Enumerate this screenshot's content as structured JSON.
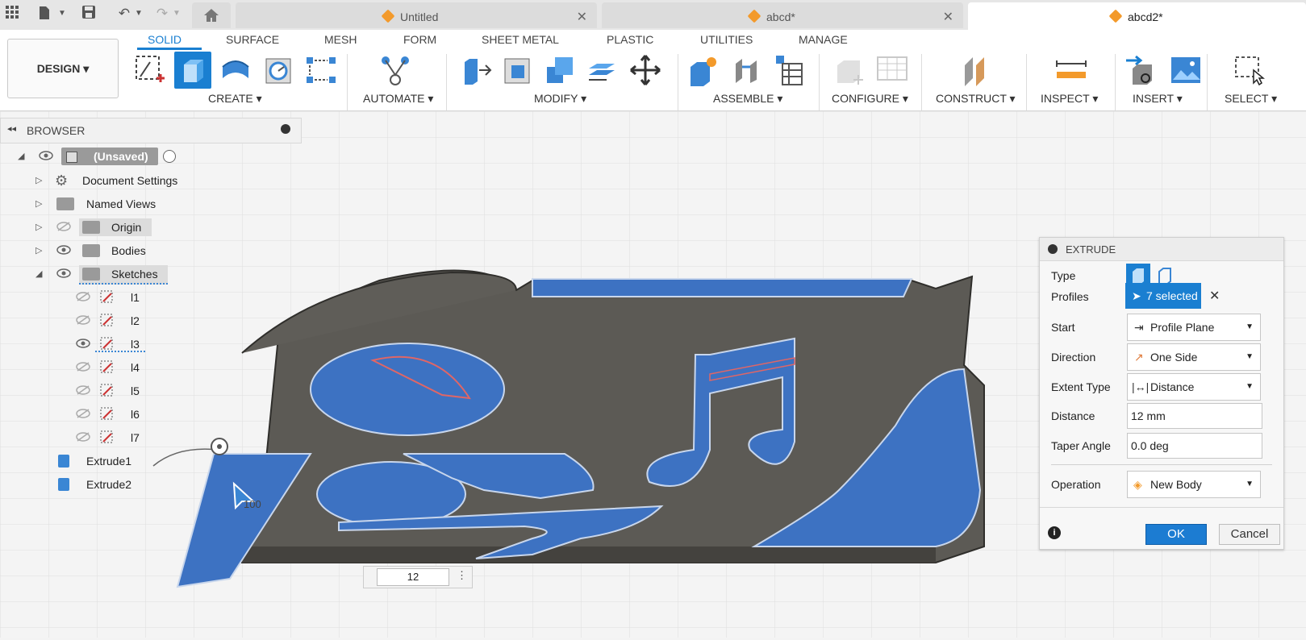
{
  "tabs": [
    {
      "label": "Untitled",
      "active": false
    },
    {
      "label": "abcd*",
      "active": false
    },
    {
      "label": "abcd2*",
      "active": true
    }
  ],
  "workspace": {
    "design_label": "DESIGN",
    "tabs": [
      "SOLID",
      "SURFACE",
      "MESH",
      "FORM",
      "SHEET METAL",
      "PLASTIC",
      "UTILITIES",
      "MANAGE"
    ],
    "groups": [
      "CREATE",
      "AUTOMATE",
      "MODIFY",
      "ASSEMBLE",
      "CONFIGURE",
      "CONSTRUCT",
      "INSPECT",
      "INSERT",
      "SELECT"
    ]
  },
  "browser": {
    "title": "BROWSER",
    "root": "(Unsaved)",
    "items": [
      "Document Settings",
      "Named Views",
      "Origin",
      "Bodies",
      "Sketches"
    ],
    "sketches": [
      "l1",
      "l2",
      "l3",
      "l4",
      "l5",
      "l6",
      "l7"
    ],
    "features": [
      "Extrude1",
      "Extrude2"
    ]
  },
  "extrude": {
    "title": "EXTRUDE",
    "type_label": "Type",
    "profiles_label": "Profiles",
    "profiles_value": "7 selected",
    "start_label": "Start",
    "start_value": "Profile Plane",
    "direction_label": "Direction",
    "direction_value": "One Side",
    "extent_label": "Extent Type",
    "extent_value": "Distance",
    "distance_label": "Distance",
    "distance_value": "12 mm",
    "taper_label": "Taper Angle",
    "taper_value": "0.0 deg",
    "operation_label": "Operation",
    "operation_value": "New Body",
    "ok_label": "OK",
    "cancel_label": "Cancel"
  },
  "viewport": {
    "distance_input": "12",
    "dim_text": "100"
  },
  "colors": {
    "accent": "#1a7fd1",
    "body": "#5c5a55",
    "extrude": "#3d72c2"
  }
}
